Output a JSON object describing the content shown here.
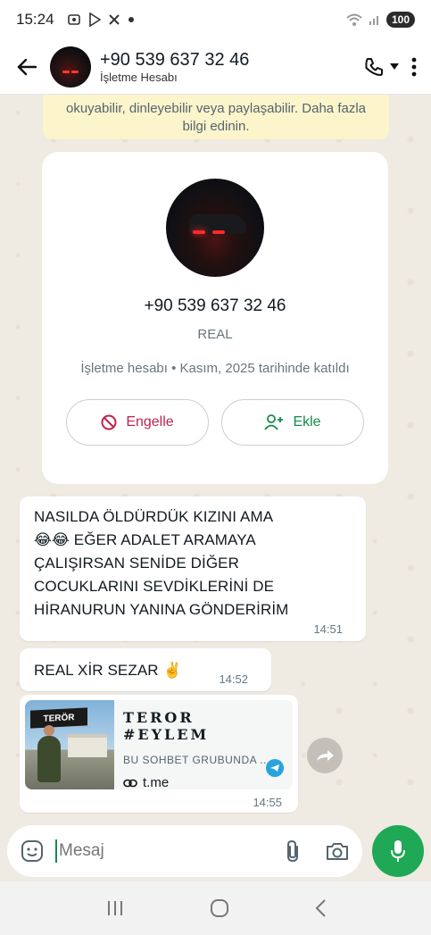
{
  "status_bar": {
    "time": "15:24",
    "battery": "100",
    "notification_icons": [
      "screen-record-icon",
      "play-store-icon",
      "x-icon",
      "dot-icon"
    ]
  },
  "header": {
    "title": "+90 539 637 32 46",
    "subtitle": "İşletme Hesabı"
  },
  "notice": {
    "line1": "okuyabilir, dinleyebilir veya paylaşabilir. Daha fazla",
    "line2": "bilgi edinin."
  },
  "profile_card": {
    "phone": "+90 539 637 32 46",
    "name": "REAL",
    "info": "İşletme hesabı • Kasım, 2025 tarihinde katıldı",
    "block_label": "Engelle",
    "add_label": "Ekle"
  },
  "messages": [
    {
      "text": "NASILDA ÖLDÜRDÜK KIZINI AMA\n😂😂 EĞER ADALET ARAMAYA\nÇALIŞIRSAN SENİDE DİĞER\nCOCUKLARINI SEVDİKLERİNİ DE\nHİRANURUN YANINA GÖNDERİRİM",
      "time": "14:51"
    },
    {
      "text": "REAL XİR SEZAR ✌️",
      "time": "14:52"
    },
    {
      "link_title": "TEROR  #EYLEM",
      "link_desc": "BU SOHBET GRUBUNDA ...",
      "link_url": "t.me",
      "thumb_flag": "TERÖR",
      "time": "14:55"
    }
  ],
  "input": {
    "placeholder": "Mesaj"
  },
  "colors": {
    "accent_green": "#1fa855",
    "block_red": "#c0234f",
    "chat_bg": "#efeae2"
  }
}
